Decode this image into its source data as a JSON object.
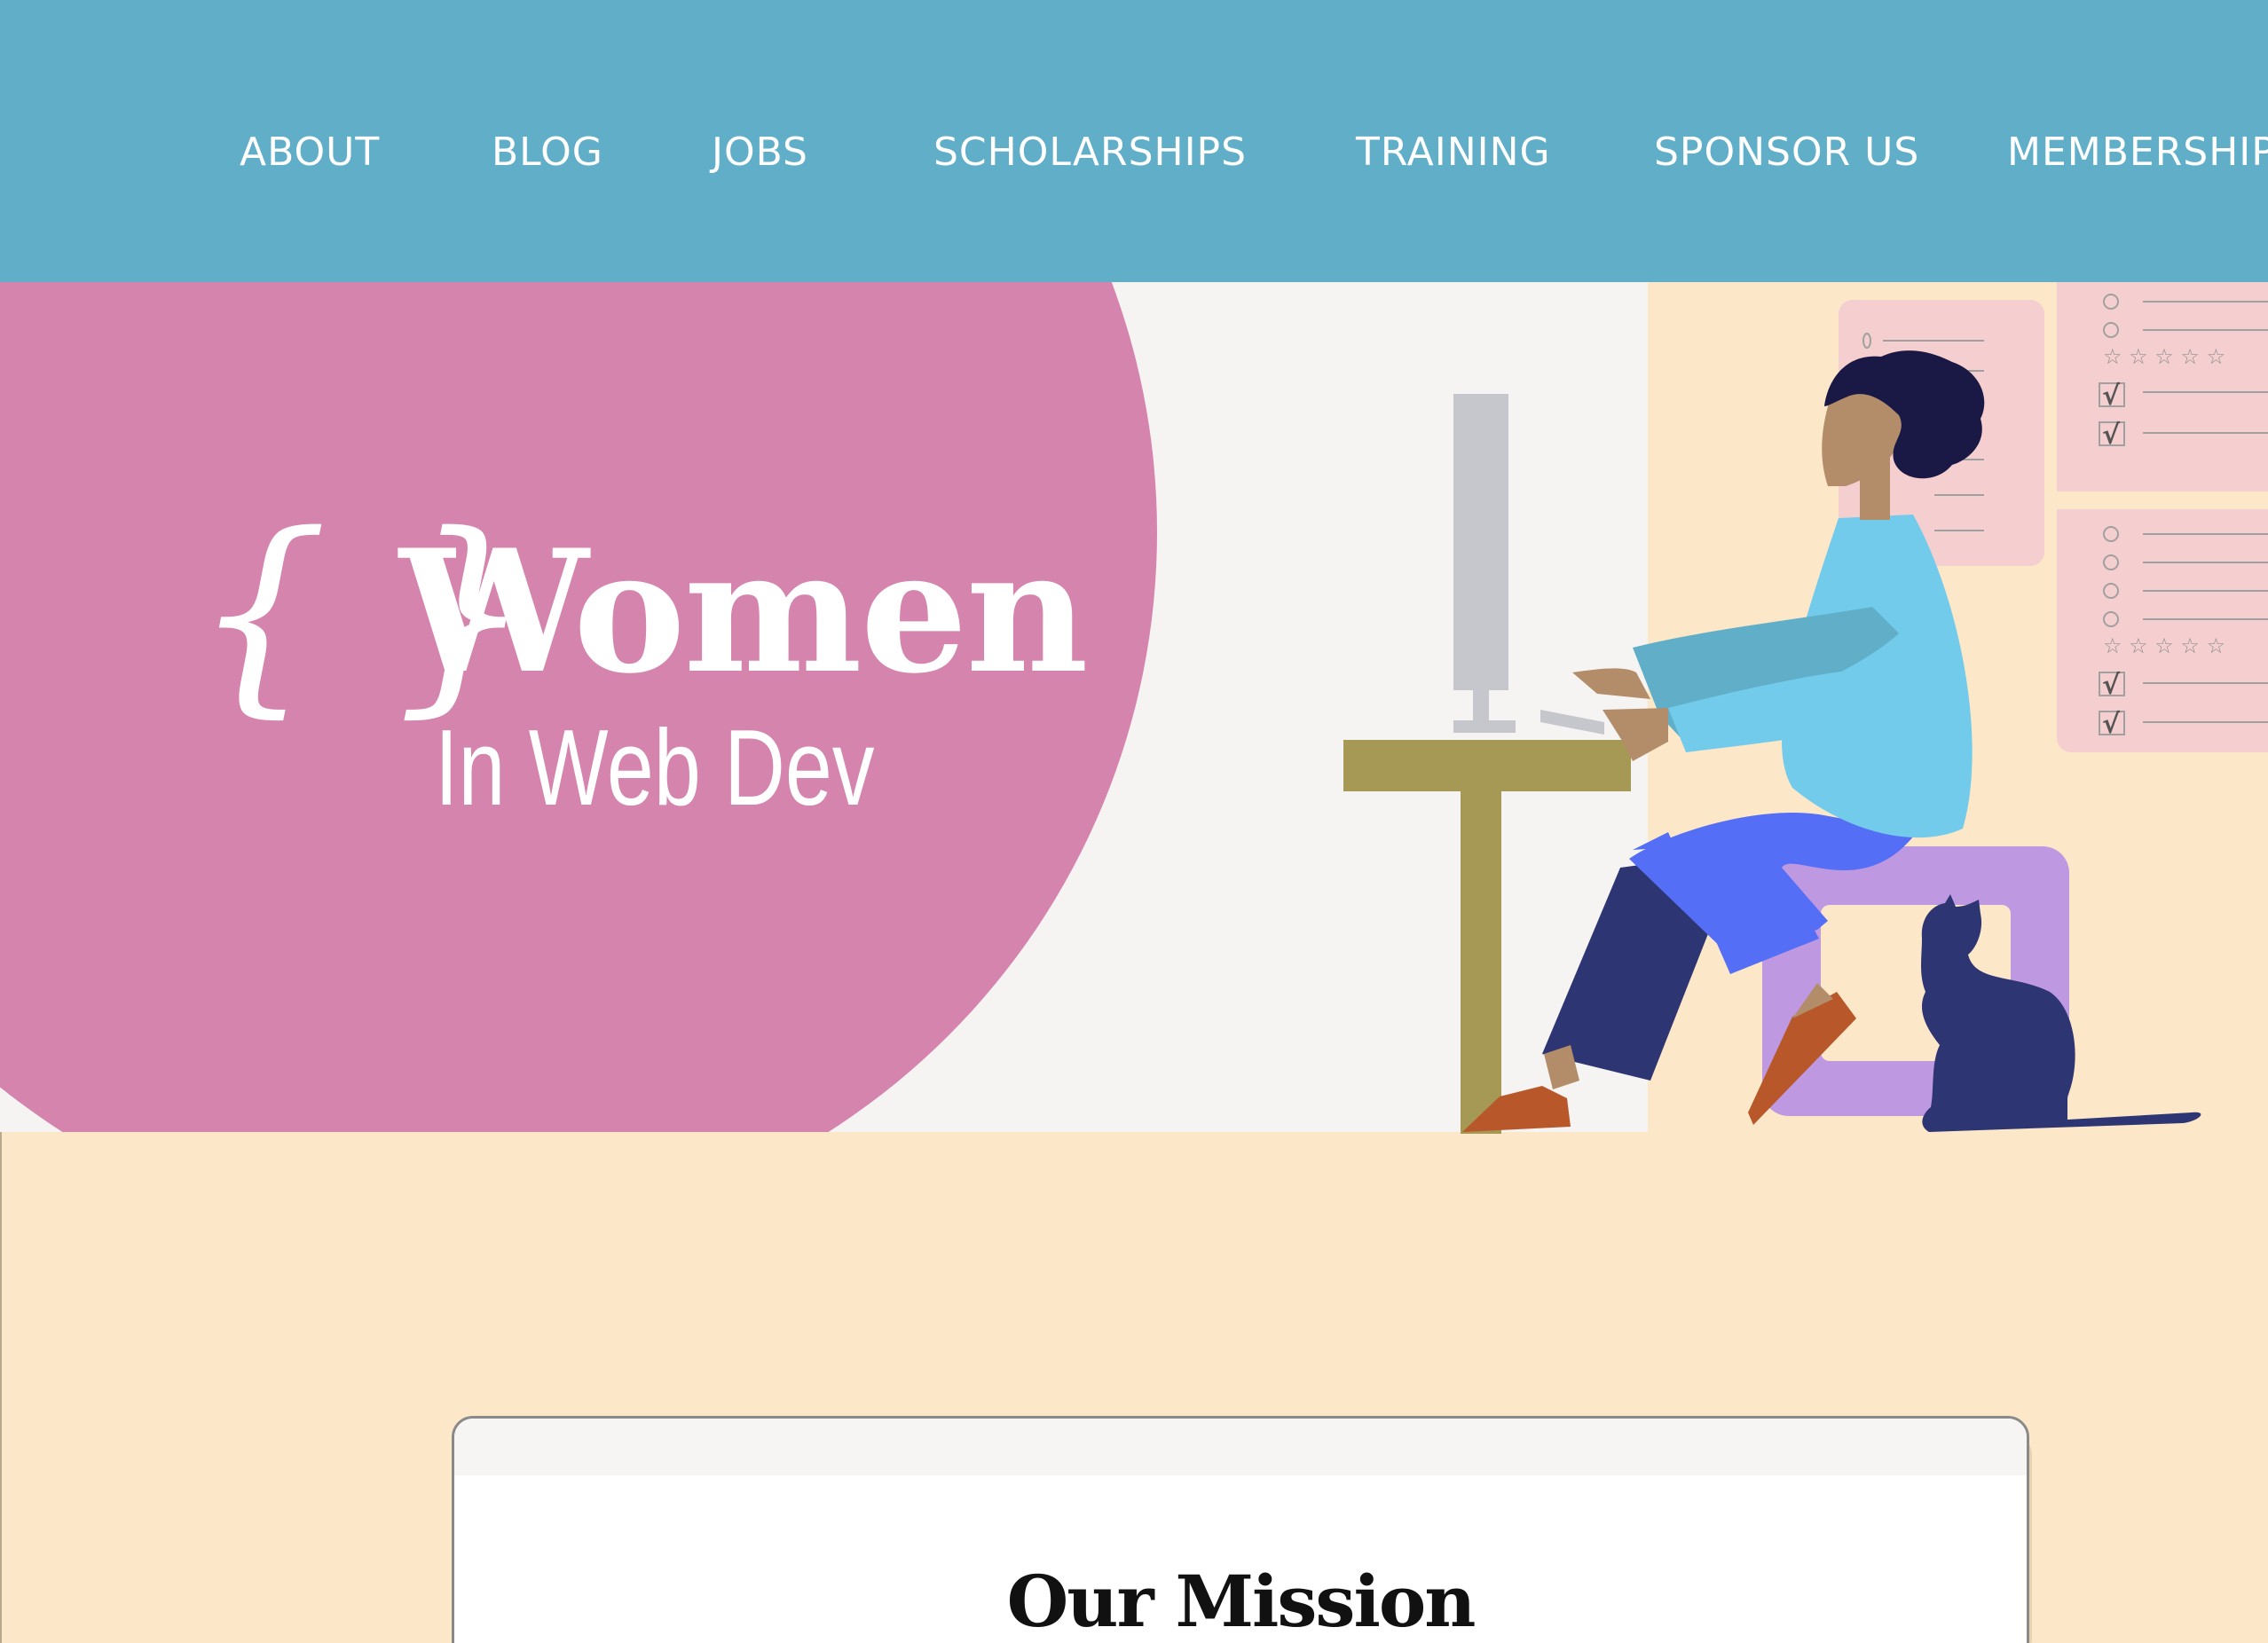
{
  "nav": {
    "items": [
      {
        "label": "ABOUT"
      },
      {
        "label": "BLOG"
      },
      {
        "label": "JOBS"
      },
      {
        "label": "SCHOLARSHIPS"
      },
      {
        "label": "TRAINING"
      },
      {
        "label": "SPONSOR US"
      },
      {
        "label": "MEMBERSHIP"
      }
    ]
  },
  "logo": {
    "braces": "{ }",
    "title": "Women",
    "subtitle": "In Web Dev"
  },
  "mission": {
    "title": "Our Mission"
  },
  "icons": {
    "logo_icon": "curly-braces-icon",
    "checkbox": "checked-checkbox-icon",
    "star": "star-icon",
    "radio": "radio-circle-icon"
  },
  "colors": {
    "nav_bg": "#60aec8",
    "circle": "#d585ad",
    "hero_bg": "#f6f4f2",
    "page_bg": "#fce8c8",
    "card_bg": "#ffffff"
  }
}
